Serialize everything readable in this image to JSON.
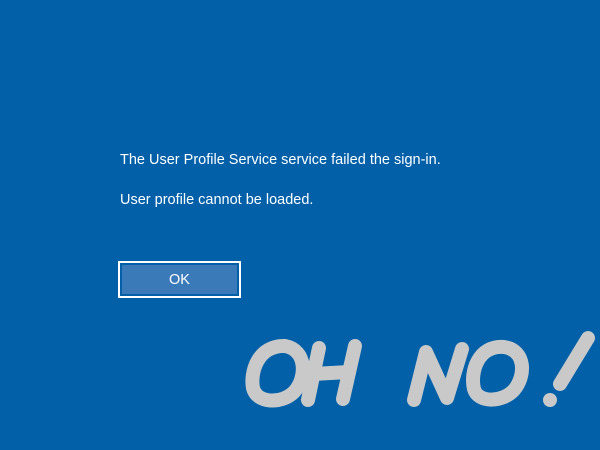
{
  "dialog": {
    "message_primary": "The User Profile Service service failed the sign-in.",
    "message_secondary": "User profile cannot be loaded.",
    "ok_label": "OK"
  },
  "overlay": {
    "text": "OH NO!",
    "color": "#c9c9c9"
  },
  "colors": {
    "background": "#0160a8",
    "button_fill": "#3a7ab8",
    "text": "#ffffff"
  }
}
